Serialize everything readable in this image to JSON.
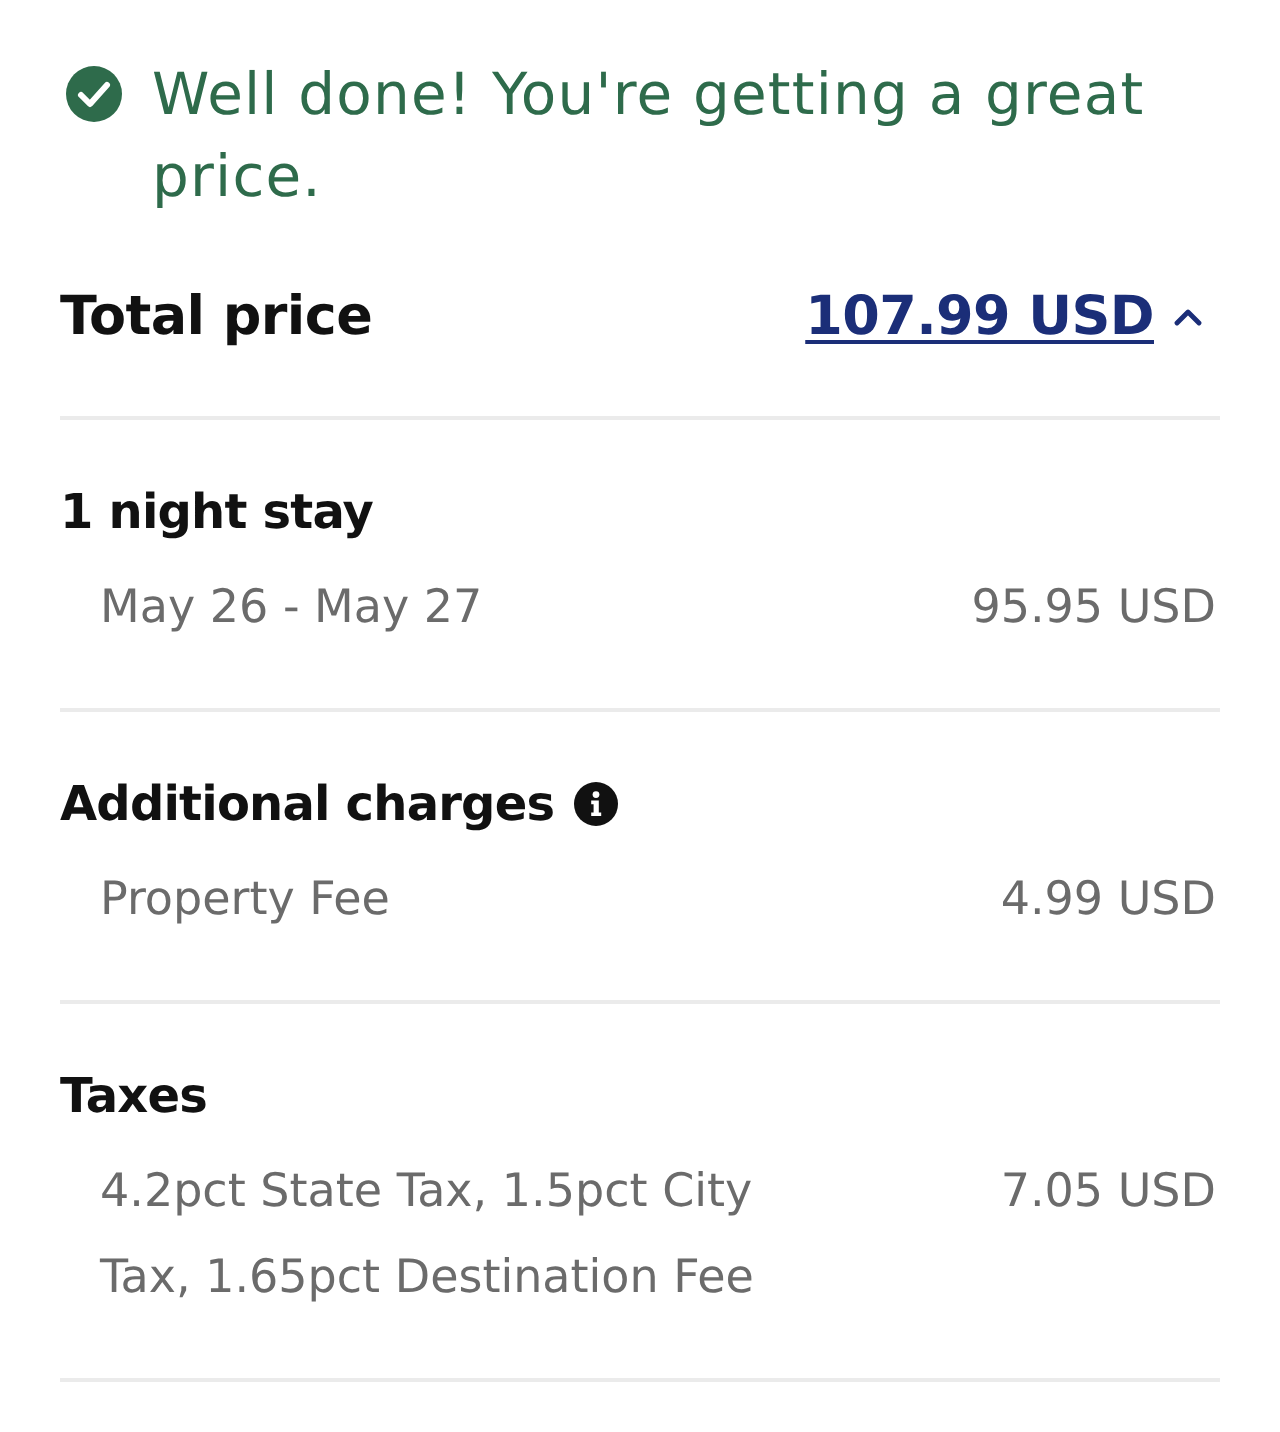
{
  "banner": {
    "message": "Well done! You're getting a great price."
  },
  "total": {
    "label": "Total price",
    "amount": "107.99 USD",
    "expanded": true
  },
  "sections": [
    {
      "title": "1 night stay",
      "info_icon": false,
      "items": [
        {
          "label": "May 26 - May 27",
          "amount": "95.95 USD"
        }
      ]
    },
    {
      "title": "Additional charges",
      "info_icon": true,
      "items": [
        {
          "label": "Property Fee",
          "amount": "4.99 USD"
        }
      ]
    },
    {
      "title": "Taxes",
      "info_icon": false,
      "items": [
        {
          "label": "4.2pct State Tax, 1.5pct City Tax, 1.65pct Destination Fee",
          "amount": "7.05 USD"
        }
      ]
    }
  ]
}
